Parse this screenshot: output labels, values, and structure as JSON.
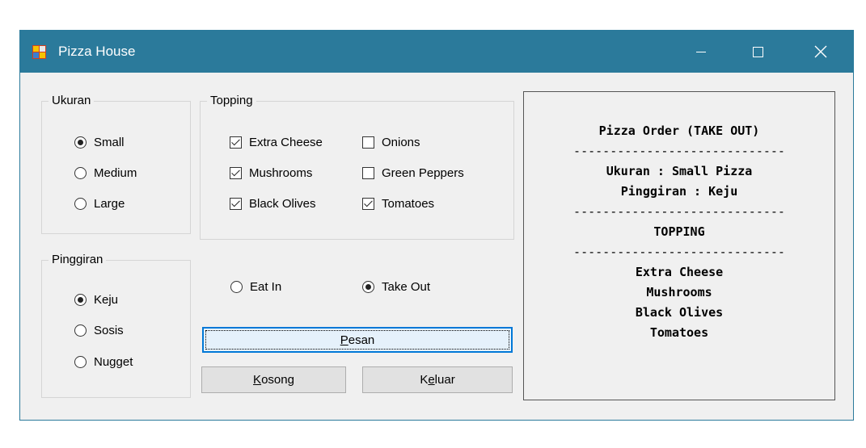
{
  "window": {
    "title": "Pizza House"
  },
  "ukuran": {
    "title": "Ukuran",
    "options": [
      {
        "label": "Small",
        "checked": true
      },
      {
        "label": "Medium",
        "checked": false
      },
      {
        "label": "Large",
        "checked": false
      }
    ]
  },
  "topping": {
    "title": "Topping",
    "options": [
      {
        "label": "Extra Cheese",
        "checked": true
      },
      {
        "label": "Onions",
        "checked": false
      },
      {
        "label": "Mushrooms",
        "checked": true
      },
      {
        "label": "Green Peppers",
        "checked": false
      },
      {
        "label": "Black Olives",
        "checked": true
      },
      {
        "label": "Tomatoes",
        "checked": true
      }
    ]
  },
  "pinggiran": {
    "title": "Pinggiran",
    "options": [
      {
        "label": "Keju",
        "checked": true
      },
      {
        "label": "Sosis",
        "checked": false
      },
      {
        "label": "Nugget",
        "checked": false
      }
    ]
  },
  "dining": {
    "options": [
      {
        "label": "Eat In",
        "checked": false
      },
      {
        "label": "Take Out",
        "checked": true
      }
    ]
  },
  "buttons": {
    "pesan": {
      "mnemonic": "P",
      "rest": "esan"
    },
    "kosong": {
      "mnemonic": "K",
      "rest": "osong"
    },
    "keluar": {
      "pre": "K",
      "mnemonic": "e",
      "rest": "luar"
    }
  },
  "output": {
    "heading": "Pizza Order (TAKE OUT)",
    "separator": "-----------------------------",
    "ukuran_line": "Ukuran : Small Pizza",
    "pinggiran_line": "Pinggiran : Keju",
    "topping_heading": "TOPPING",
    "toppings": [
      "Extra Cheese",
      "Mushrooms",
      "Black Olives",
      "Tomatoes"
    ]
  }
}
